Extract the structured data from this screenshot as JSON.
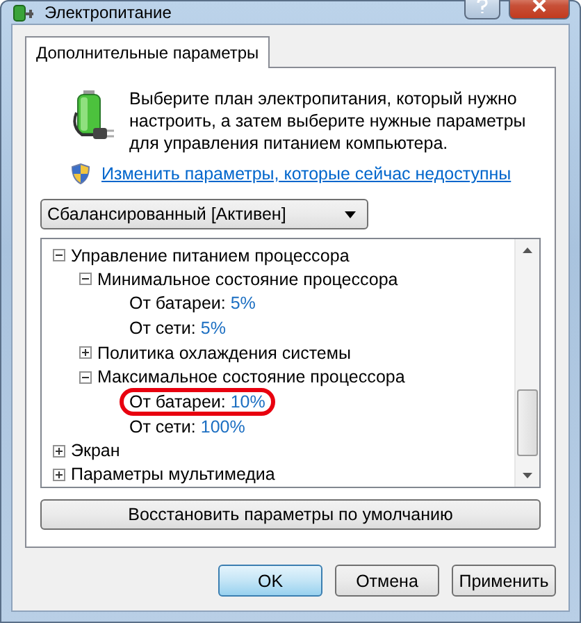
{
  "window": {
    "title": "Электропитание"
  },
  "tabs": [
    {
      "label": "Дополнительные параметры",
      "selected": true
    }
  ],
  "intro": "Выберите план электропитания, который нужно настроить, а затем выберите нужные параметры для управления питанием компьютера.",
  "admin_link": "Изменить параметры, которые сейчас недоступны",
  "plan_select": {
    "value": "Сбалансированный [Активен]"
  },
  "tree": [
    {
      "label": "Управление питанием процессора",
      "expanded": true,
      "children": [
        {
          "label": "Минимальное состояние процессора",
          "expanded": true,
          "children": [
            {
              "label": "От батареи:",
              "value": "5%",
              "highlighted": false
            },
            {
              "label": "От сети:",
              "value": "5%",
              "highlighted": false
            }
          ]
        },
        {
          "label": "Политика охлаждения системы",
          "expanded": false
        },
        {
          "label": "Максимальное состояние процессора",
          "expanded": true,
          "children": [
            {
              "label": "От батареи:",
              "value": "10%",
              "highlighted": true
            },
            {
              "label": "От сети:",
              "value": "100%",
              "highlighted": false
            }
          ]
        }
      ]
    },
    {
      "label": "Экран",
      "expanded": false
    },
    {
      "label": "Параметры мультимедиа",
      "expanded": false
    }
  ],
  "restore_button": "Восстановить параметры по умолчанию",
  "buttons": [
    {
      "label": "OK",
      "default": true
    },
    {
      "label": "Отмена",
      "default": false
    },
    {
      "label": "Применить",
      "default": false
    }
  ]
}
